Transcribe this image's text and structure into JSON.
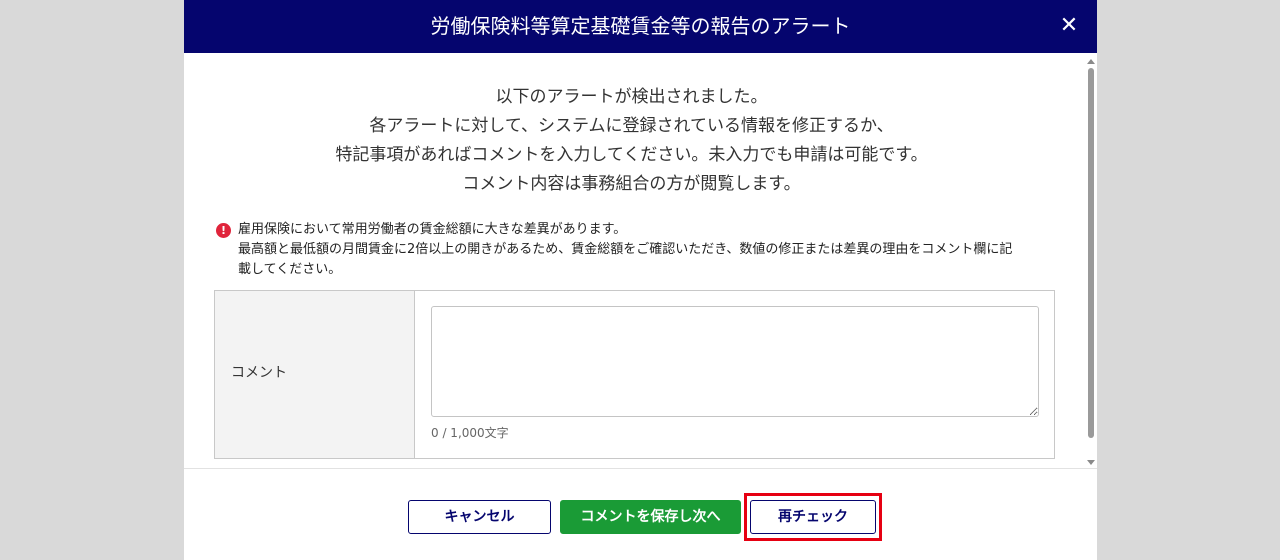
{
  "modal": {
    "title": "労働保険料等算定基礎賃金等の報告のアラート",
    "close_symbol": "✕"
  },
  "intro": {
    "lines": [
      "以下のアラートが検出されました。",
      "各アラートに対して、システムに登録されている情報を修正するか、",
      "特記事項があればコメントを入力してください。未入力でも申請は可能です。",
      "コメント内容は事務組合の方が閲覧します。"
    ]
  },
  "alert": {
    "icon_symbol": "!",
    "icon_color": "#e0243b",
    "lines": [
      "雇用保険において常用労働者の賃金総額に大きな差異があります。",
      "最高額と最低額の月間賃金に2倍以上の開きがあるため、賃金総額をご確認いただき、数値の修正または差異の理由をコメント欄に記",
      "載してください。"
    ]
  },
  "comment": {
    "label": "コメント",
    "value": "",
    "char_count": "0 / 1,000文字"
  },
  "footer": {
    "cancel_label": "キャンセル",
    "save_next_label": "コメントを保存し次へ",
    "recheck_label": "再チェック",
    "highlight_color": "#e60012"
  },
  "colors": {
    "header_bg": "#05056e",
    "save_bg": "#1a9b36",
    "overlay": "#d9d9d9"
  }
}
